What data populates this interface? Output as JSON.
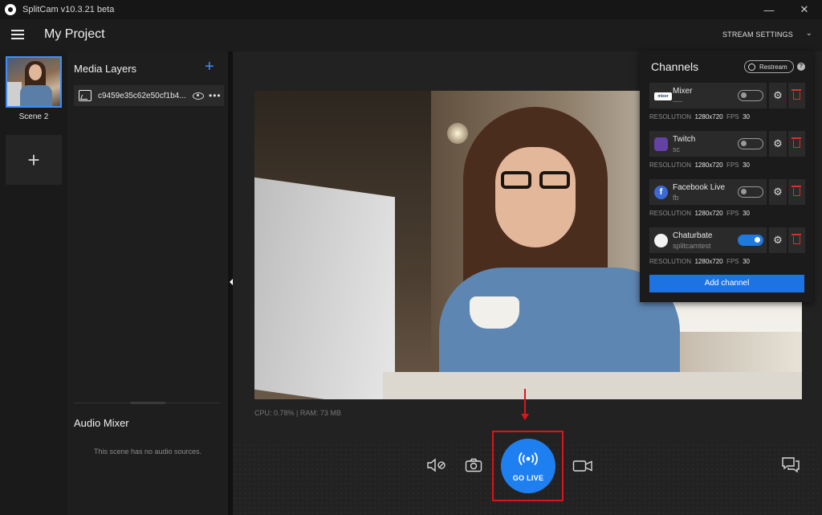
{
  "window": {
    "title": "SplitCam v10.3.21 beta",
    "minimize": "—",
    "close": "✕"
  },
  "header": {
    "project_title": "My Project",
    "stream_settings_label": "STREAM SETTINGS",
    "stream_settings_chevron": "⌄"
  },
  "scenes": {
    "items": [
      {
        "label": "Scene 2",
        "selected": true
      }
    ],
    "add_label": "+"
  },
  "media_layers": {
    "title": "Media Layers",
    "add_label": "+",
    "items": [
      {
        "name": "c9459e35c62e50cf1b4..."
      }
    ],
    "more_label": "•••"
  },
  "audio_mixer": {
    "title": "Audio Mixer",
    "empty_text": "This scene has no audio sources."
  },
  "stats": {
    "text": "CPU: 0.78% | RAM: 73 MB"
  },
  "channels": {
    "title": "Channels",
    "restream_label": "Restream",
    "help_label": "?",
    "resolution_label": "RESOLUTION",
    "fps_label": "FPS",
    "gear_glyph": "⚙",
    "items": [
      {
        "name": "Mixer",
        "sub": "----",
        "logo": "mixer-logo",
        "logo_text": "mixer",
        "enabled": false,
        "resolution": "1280x720",
        "fps": "30"
      },
      {
        "name": "Twitch",
        "sub": "sc",
        "logo": "twitch-logo",
        "logo_text": "",
        "enabled": false,
        "resolution": "1280x720",
        "fps": "30"
      },
      {
        "name": "Facebook Live",
        "sub": "fb",
        "logo": "facebook-logo",
        "logo_text": "f",
        "enabled": false,
        "resolution": "1280x720",
        "fps": "30"
      },
      {
        "name": "Chaturbate",
        "sub": "splitcamtest",
        "logo": "chaturbate-logo",
        "logo_text": "",
        "enabled": true,
        "resolution": "1280x720",
        "fps": "30"
      }
    ],
    "add_channel_label": "Add channel"
  },
  "controls": {
    "go_live_label": "GO LIVE",
    "icons": [
      "mute-mic-icon",
      "snapshot-camera-icon",
      "broadcast-icon",
      "video-camera-icon",
      "chat-icon"
    ]
  },
  "colors": {
    "accent": "#1e80f0",
    "highlight_red": "#e0131b",
    "delete_red": "#d9322b"
  }
}
